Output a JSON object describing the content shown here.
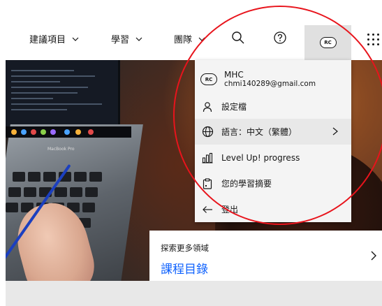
{
  "nav": {
    "items": [
      {
        "label": "建議項目"
      },
      {
        "label": "學習"
      },
      {
        "label": "團隊"
      }
    ],
    "avatar_initials": "RC"
  },
  "menu": {
    "user": {
      "initials": "RC",
      "name": "MHC",
      "email": "chmi140289@gmail.com"
    },
    "items": [
      {
        "label": "設定檔",
        "icon": "user-icon"
      },
      {
        "label": "語言：中文（繁體）",
        "icon": "globe-icon"
      },
      {
        "label": "Level Up! progress",
        "icon": "progress-icon"
      },
      {
        "label": "您的學習摘要",
        "icon": "clipboard-icon"
      },
      {
        "label": "登出",
        "icon": "arrow-left-icon"
      }
    ]
  },
  "hero": {
    "laptop_label": "MacBook Pro"
  },
  "card": {
    "subtitle": "探索更多領域",
    "title": "課程目錄"
  },
  "colors": {
    "accent": "#0f62fe",
    "annotation": "#e8141c",
    "menu_bg": "#f4f4f4",
    "avatar_bg": "#e0e0e0"
  }
}
